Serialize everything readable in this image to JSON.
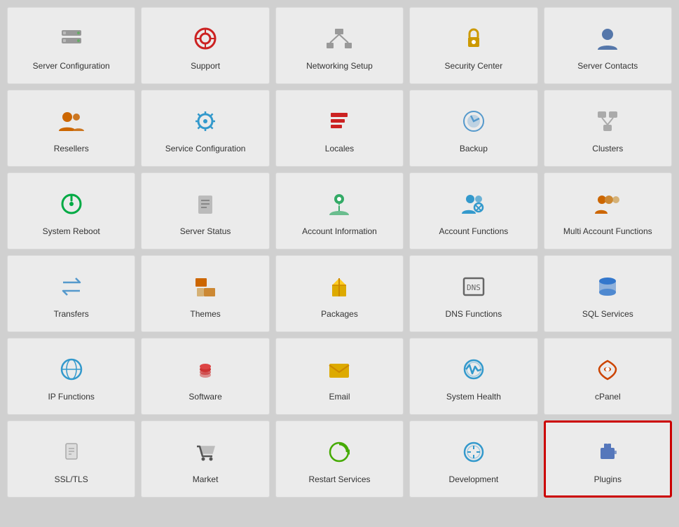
{
  "tiles": [
    {
      "id": "server-configuration",
      "label": "Server Configuration",
      "icon": "🖥️",
      "iconClass": "icon-server-config",
      "highlighted": false
    },
    {
      "id": "support",
      "label": "Support",
      "icon": "🛟",
      "iconClass": "icon-support",
      "highlighted": false
    },
    {
      "id": "networking-setup",
      "label": "Networking Setup",
      "icon": "🖧",
      "iconClass": "icon-networking",
      "highlighted": false
    },
    {
      "id": "security-center",
      "label": "Security Center",
      "icon": "🔒",
      "iconClass": "icon-security",
      "highlighted": false
    },
    {
      "id": "server-contacts",
      "label": "Server Contacts",
      "icon": "👤",
      "iconClass": "icon-contacts",
      "highlighted": false
    },
    {
      "id": "resellers",
      "label": "Resellers",
      "icon": "👥",
      "iconClass": "icon-resellers",
      "highlighted": false
    },
    {
      "id": "service-configuration",
      "label": "Service Configuration",
      "icon": "⚙️",
      "iconClass": "icon-service-config",
      "highlighted": false
    },
    {
      "id": "locales",
      "label": "Locales",
      "icon": "🗂️",
      "iconClass": "icon-locales",
      "highlighted": false
    },
    {
      "id": "backup",
      "label": "Backup",
      "icon": "🔵",
      "iconClass": "icon-backup",
      "highlighted": false
    },
    {
      "id": "clusters",
      "label": "Clusters",
      "icon": "🖧",
      "iconClass": "icon-clusters",
      "highlighted": false
    },
    {
      "id": "system-reboot",
      "label": "System Reboot",
      "icon": "🔄",
      "iconClass": "icon-reboot",
      "highlighted": false
    },
    {
      "id": "server-status",
      "label": "Server Status",
      "icon": "📋",
      "iconClass": "icon-server-status",
      "highlighted": false
    },
    {
      "id": "account-information",
      "label": "Account Information",
      "icon": "ℹ️",
      "iconClass": "icon-account-info",
      "highlighted": false
    },
    {
      "id": "account-functions",
      "label": "Account Functions",
      "icon": "⚙️",
      "iconClass": "icon-account-func",
      "highlighted": false
    },
    {
      "id": "multi-account-functions",
      "label": "Multi Account Functions",
      "icon": "👥",
      "iconClass": "icon-multi-account",
      "highlighted": false
    },
    {
      "id": "transfers",
      "label": "Transfers",
      "icon": "🔀",
      "iconClass": "icon-transfers",
      "highlighted": false
    },
    {
      "id": "themes",
      "label": "Themes",
      "icon": "🎨",
      "iconClass": "icon-themes",
      "highlighted": false
    },
    {
      "id": "packages",
      "label": "Packages",
      "icon": "📦",
      "iconClass": "icon-packages",
      "highlighted": false
    },
    {
      "id": "dns-functions",
      "label": "DNS Functions",
      "icon": "🌐",
      "iconClass": "icon-dns",
      "highlighted": false
    },
    {
      "id": "sql-services",
      "label": "SQL Services",
      "icon": "🔷",
      "iconClass": "icon-sql",
      "highlighted": false
    },
    {
      "id": "ip-functions",
      "label": "IP Functions",
      "icon": "🌍",
      "iconClass": "icon-ip",
      "highlighted": false
    },
    {
      "id": "software",
      "label": "Software",
      "icon": "💾",
      "iconClass": "icon-software",
      "highlighted": false
    },
    {
      "id": "email",
      "label": "Email",
      "icon": "✉️",
      "iconClass": "icon-email",
      "highlighted": false
    },
    {
      "id": "system-health",
      "label": "System Health",
      "icon": "⚙️",
      "iconClass": "icon-system-health",
      "highlighted": false
    },
    {
      "id": "cpanel",
      "label": "cPanel",
      "icon": "♾️",
      "iconClass": "icon-cpanel",
      "highlighted": false
    },
    {
      "id": "ssltls",
      "label": "SSL/TLS",
      "icon": "📄",
      "iconClass": "icon-ssltls",
      "highlighted": false
    },
    {
      "id": "market",
      "label": "Market",
      "icon": "🛒",
      "iconClass": "icon-market",
      "highlighted": false
    },
    {
      "id": "restart-services",
      "label": "Restart Services",
      "icon": "🔃",
      "iconClass": "icon-restart",
      "highlighted": false
    },
    {
      "id": "development",
      "label": "Development",
      "icon": "⚙️",
      "iconClass": "icon-development",
      "highlighted": false
    },
    {
      "id": "plugins",
      "label": "Plugins",
      "icon": "🔌",
      "iconClass": "icon-plugins",
      "highlighted": true
    }
  ],
  "icons": {
    "server-configuration": "server-config-icon",
    "support": "support-icon",
    "networking-setup": "networking-icon",
    "security-center": "security-icon",
    "server-contacts": "contacts-icon"
  }
}
